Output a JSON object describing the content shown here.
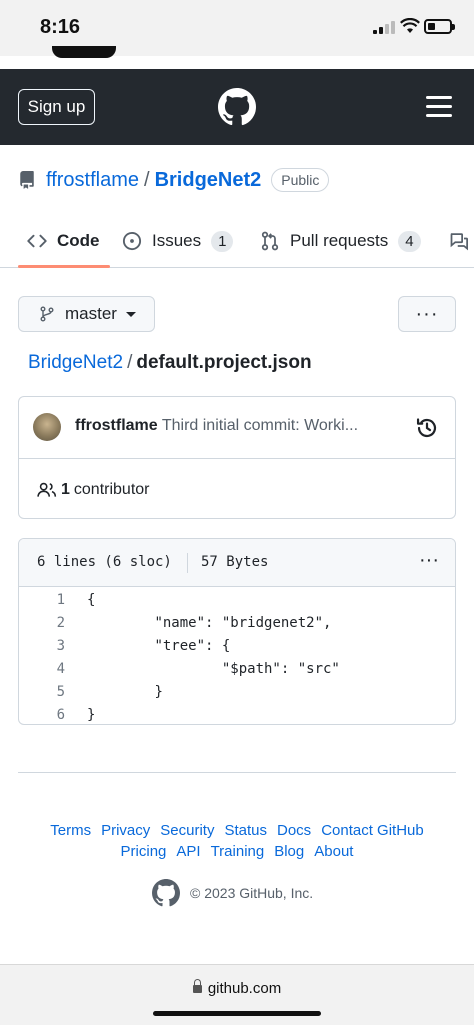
{
  "status_bar": {
    "time": "8:16"
  },
  "header": {
    "signup_label": "Sign up"
  },
  "repo": {
    "owner": "ffrostflame",
    "separator": "/",
    "name": "BridgeNet2",
    "visibility": "Public"
  },
  "tabs": [
    {
      "label": "Code",
      "icon": "code-icon"
    },
    {
      "label": "Issues",
      "icon": "issue-opened-icon",
      "count": "1"
    },
    {
      "label": "Pull requests",
      "icon": "git-pull-request-icon",
      "count": "4"
    },
    {
      "label": "",
      "icon": "discussions-icon"
    }
  ],
  "branch": {
    "label": "master",
    "more_label": "···"
  },
  "breadcrumb": {
    "repo": "BridgeNet2",
    "separator": "/",
    "file": "default.project.json"
  },
  "commit": {
    "author": "ffrostflame",
    "message": "Third initial commit: Worki...",
    "contributors_count": "1",
    "contributors_label": "contributor"
  },
  "file": {
    "lines_info": "6 lines (6 sloc)",
    "size": "57 Bytes",
    "more_label": "···",
    "code": [
      {
        "n": "1",
        "text": "{"
      },
      {
        "n": "2",
        "text": "\t\"name\": \"bridgenet2\","
      },
      {
        "n": "3",
        "text": "\t\"tree\": {"
      },
      {
        "n": "4",
        "text": "\t\t\"$path\": \"src\""
      },
      {
        "n": "5",
        "text": "\t}"
      },
      {
        "n": "6",
        "text": "}"
      }
    ]
  },
  "footer": {
    "links_row1": [
      "Terms",
      "Privacy",
      "Security",
      "Status",
      "Docs",
      "Contact GitHub"
    ],
    "links_row2": [
      "Pricing",
      "API",
      "Training",
      "Blog",
      "About"
    ],
    "copyright": "© 2023 GitHub, Inc."
  },
  "browser": {
    "url": "github.com"
  },
  "colors": {
    "header_bg": "#24292f",
    "link": "#0969da",
    "tab_underline": "#fd8c73",
    "border": "#d0d7de"
  }
}
